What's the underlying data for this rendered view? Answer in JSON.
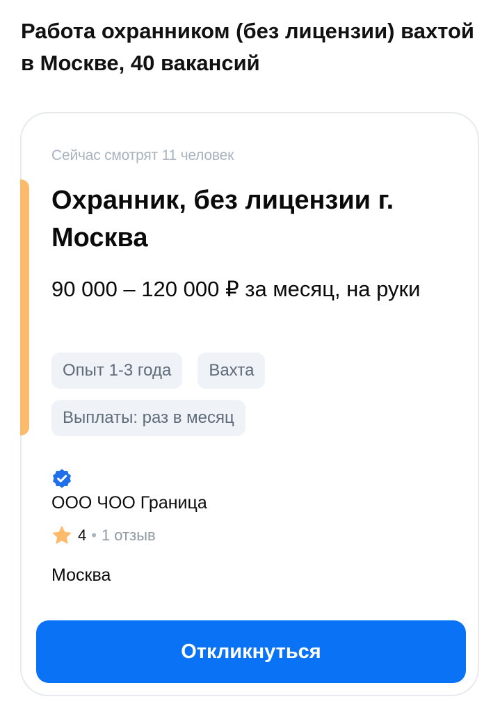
{
  "page": {
    "heading": "Работа охранником (без лицензии) вахтой в Москве, 40 вакансий"
  },
  "vacancy": {
    "viewers": "Сейчас смотрят 11 человек",
    "title": "Охранник, без лицензии г. Москва",
    "salary": "90 000 – 120 000 ₽ за месяц, на руки",
    "tags": [
      "Опыт 1-3 года",
      "Вахта",
      "Выплаты: раз в месяц"
    ],
    "company": "ООО ЧОО Граница",
    "rating": "4",
    "rating_separator": "•",
    "reviews": "1 отзыв",
    "city": "Москва",
    "apply_label": "Откликнуться",
    "icons": {
      "verified": "verified-badge-icon",
      "rating": "star-icon"
    }
  },
  "colors": {
    "accent": "#fcba6b",
    "button": "#0a72f5",
    "verified": "#1f6feb",
    "star": "#fcba6b"
  }
}
